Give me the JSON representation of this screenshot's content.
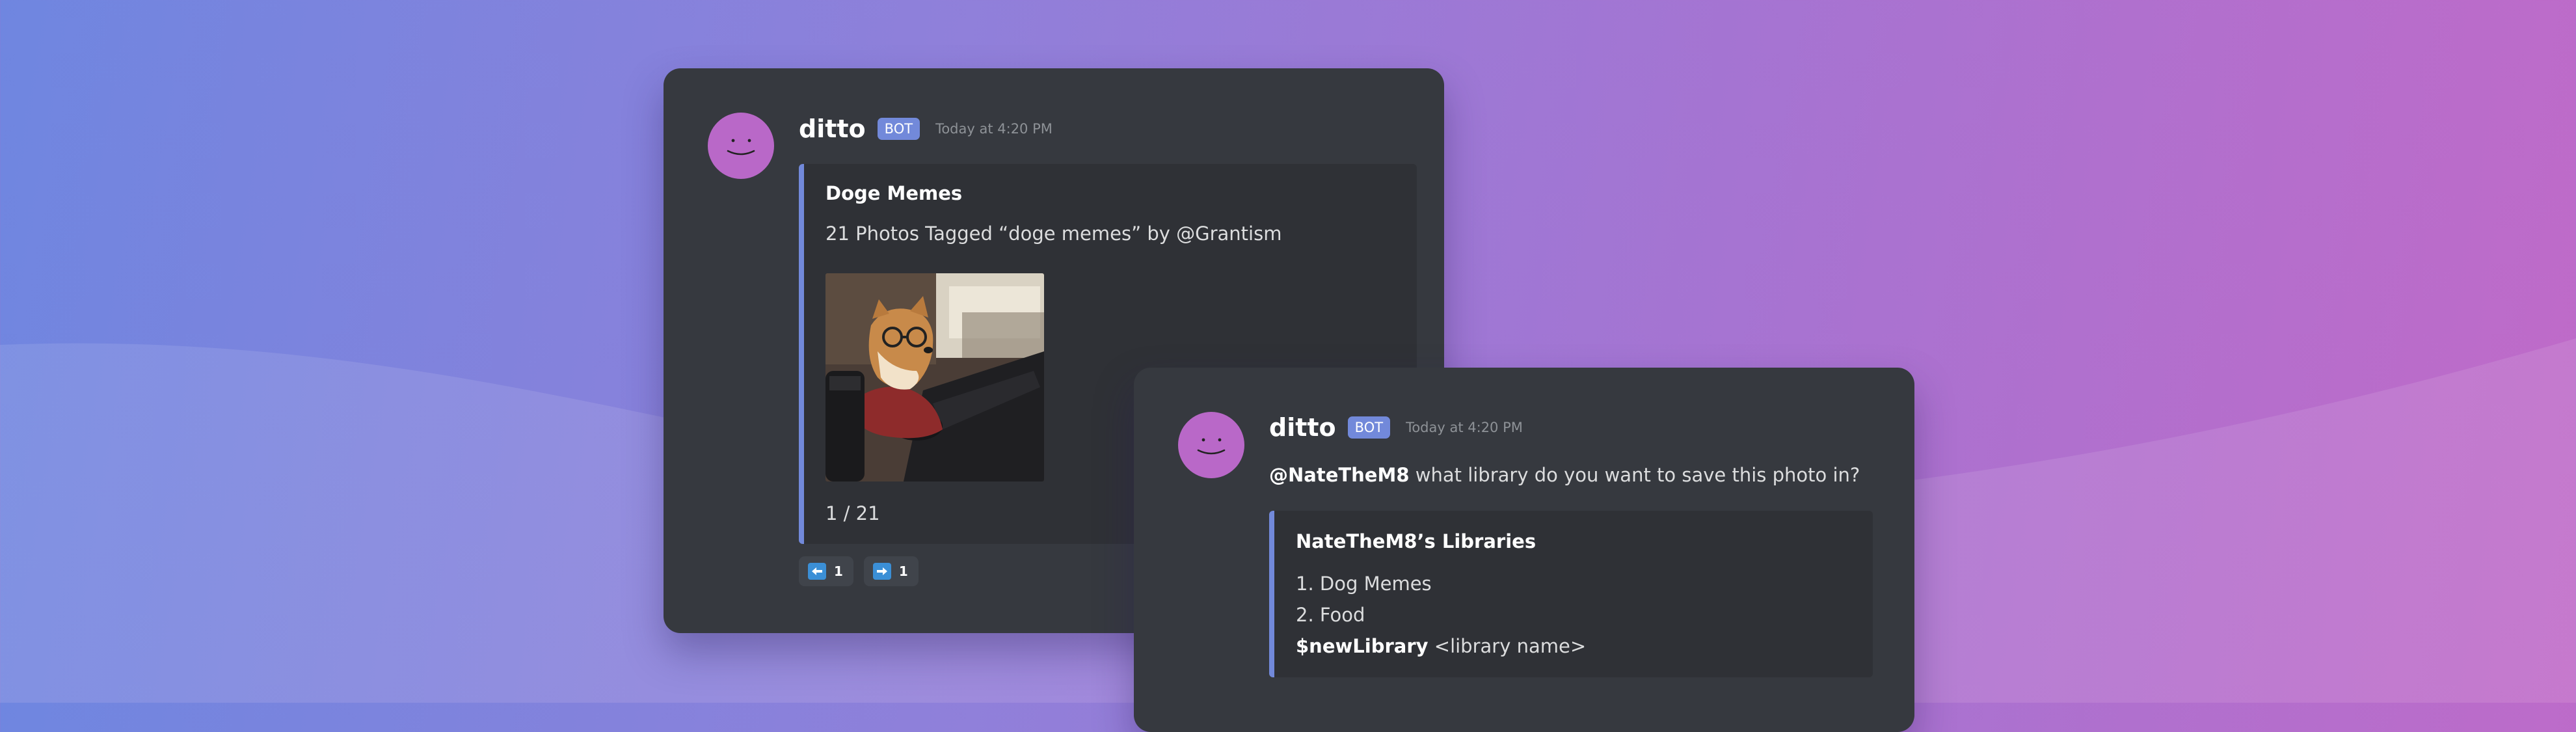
{
  "colors": {
    "card_bg": "#36393f",
    "embed_bg": "#2f3136",
    "embed_accent": "#7289da",
    "badge_bg": "#7289da",
    "avatar": "#b968c8",
    "reaction_bg": "#40444b",
    "timestamp": "#8e9297"
  },
  "message1": {
    "avatar_icon": "smiley-face-icon",
    "username": "ditto",
    "badge": "BOT",
    "timestamp": "Today at 4:20 PM",
    "embed": {
      "title": "Doge Memes",
      "description": "21 Photos Tagged “doge memes” by @Grantism",
      "image": "shiba-dog-with-glasses-at-computer-photo",
      "footer": "1 / 21"
    },
    "reactions": [
      {
        "icon": "arrow-left-icon",
        "count": "1"
      },
      {
        "icon": "arrow-right-icon",
        "count": "1"
      }
    ]
  },
  "message2": {
    "avatar_icon": "smiley-face-icon",
    "username": "ditto",
    "badge": "BOT",
    "timestamp": "Today at 4:20 PM",
    "mention": "@NateTheM8",
    "text": "what library do you want to save this photo in?",
    "embed": {
      "title": "NateTheM8’s Libraries",
      "items": [
        "1. Dog Memes",
        "2. Food"
      ],
      "command": "$newLibrary",
      "command_arg": "<library name>"
    }
  }
}
